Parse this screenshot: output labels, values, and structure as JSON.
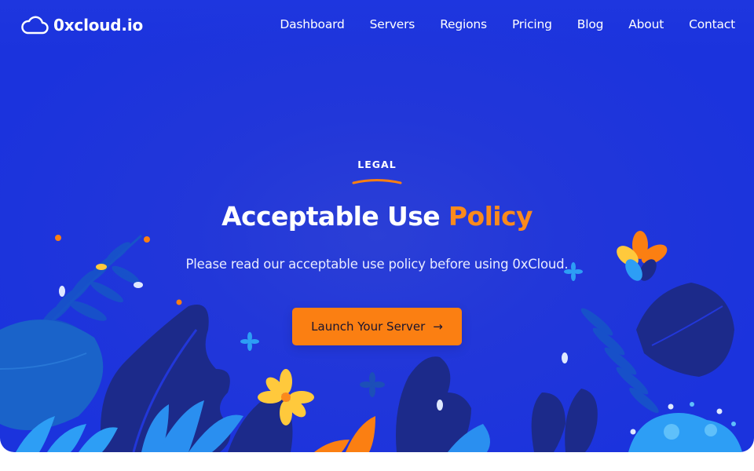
{
  "brand": {
    "name": "0xcloud.io",
    "logo_icon": "cloud-icon"
  },
  "nav": {
    "items": [
      {
        "label": "Dashboard"
      },
      {
        "label": "Servers"
      },
      {
        "label": "Regions"
      },
      {
        "label": "Pricing"
      },
      {
        "label": "Blog"
      },
      {
        "label": "About"
      },
      {
        "label": "Contact"
      }
    ]
  },
  "hero": {
    "eyebrow": "LEGAL",
    "title_main": "Acceptable Use",
    "title_accent": "Policy",
    "subtitle": "Please read our acceptable use policy before using 0xCloud.",
    "cta_label": "Launch Your Server",
    "cta_icon": "arrow-right-icon"
  },
  "colors": {
    "background": "#1f35dc",
    "accent": "#fb8a1c",
    "button": "#fb7f12",
    "text": "#ffffff"
  }
}
